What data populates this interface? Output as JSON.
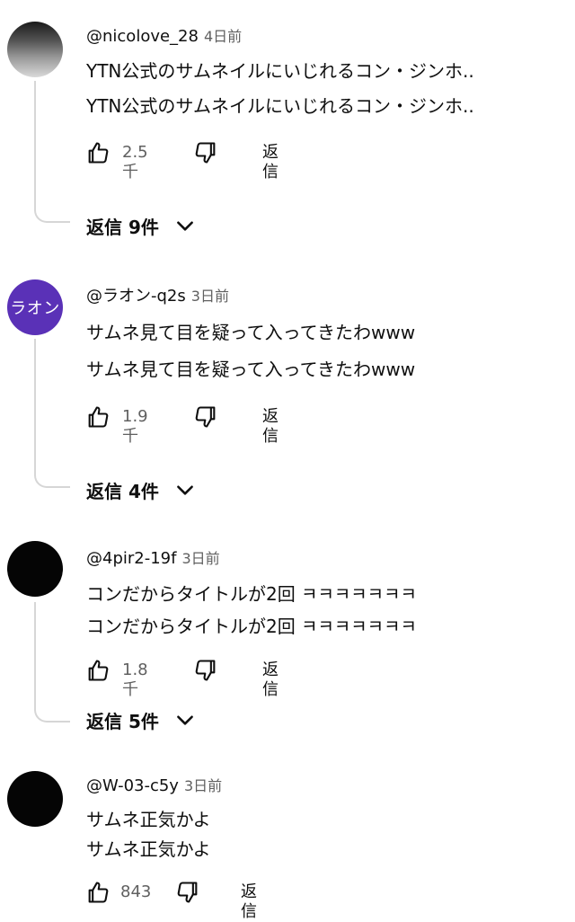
{
  "comments": [
    {
      "handle": "@nicolove_28",
      "time": "4日前",
      "avatar_style": "grayscale-photo",
      "lines": [
        "YTN公式のサムネイルにいじれるコン・ジンホ..",
        "YTN公式のサムネイルにいじれるコン・ジンホ.."
      ],
      "likes": "2.5千",
      "reply_label": "返信",
      "replies": "返信 9件"
    },
    {
      "handle": "@ラオン-q2s",
      "time": "3日前",
      "avatar_text": "ラオン",
      "avatar_color": "#5a31b7",
      "lines": [
        "サムネ見て目を疑って入ってきたわwww",
        "サムネ見て目を疑って入ってきたわwww"
      ],
      "likes": "1.9千",
      "reply_label": "返信",
      "replies": "返信 4件"
    },
    {
      "handle": "@4pir2-19f",
      "time": "3日前",
      "avatar_color": "#050505",
      "lines": [
        "コンだからタイトルが2回 ㅋㅋㅋㅋㅋㅋㅋ",
        "コンだからタイトルが2回 ㅋㅋㅋㅋㅋㅋㅋ"
      ],
      "likes": "1.8千",
      "reply_label": "返信",
      "replies": "返信 5件"
    },
    {
      "handle": "@W-03-c5y",
      "time": "3日前",
      "avatar_color": "#050505",
      "lines": [
        "サムネ正気かよ",
        "サムネ正気かよ"
      ],
      "likes": "843",
      "reply_label": "返信"
    }
  ],
  "icons": {
    "like": "thumb-up-icon",
    "dislike": "thumb-down-icon",
    "expand": "chevron-down-icon"
  }
}
